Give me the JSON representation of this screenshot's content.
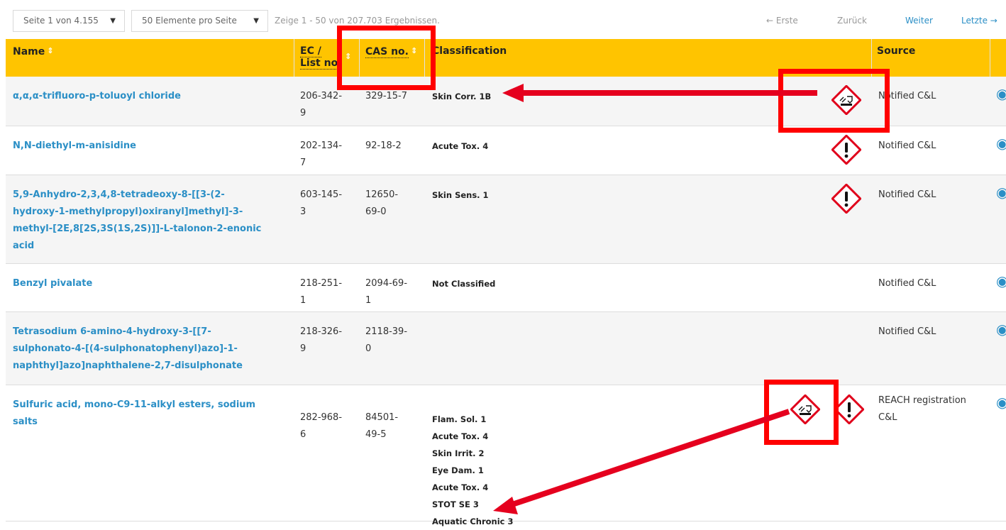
{
  "toolbar": {
    "page_select": "Seite 1 von 4.155",
    "per_page_select": "50 Elemente pro Seite",
    "results_info": "Zeige 1 - 50 von 207.703 Ergebnissen.",
    "first": "← Erste",
    "prev": "Zurück",
    "next": "Weiter",
    "last": "Letzte →"
  },
  "header": {
    "name": "Name",
    "ec_line1": "EC /",
    "ec_line2": "List no.",
    "cas": "CAS no.",
    "classification": "Classification",
    "source": "Source",
    "sort_icon": "sort-arrows-icon"
  },
  "rows": [
    {
      "name_lines": [
        "α,α,α-trifluoro-p-toluoyl chloride"
      ],
      "ec": [
        "206-342-",
        "9"
      ],
      "cas": [
        "329-15-7"
      ],
      "classification": [
        "Skin Corr. 1B"
      ],
      "pictograms": [
        "corrosion-pictogram"
      ],
      "source": [
        "Notified C&L"
      ]
    },
    {
      "name_lines": [
        "N,N-diethyl-m-anisidine"
      ],
      "ec": [
        "202-134-",
        "7"
      ],
      "cas": [
        "92-18-2"
      ],
      "classification": [
        "Acute Tox. 4"
      ],
      "pictograms": [
        "exclamation-pictogram"
      ],
      "source": [
        "Notified C&L"
      ]
    },
    {
      "name_lines": [
        "5,9-Anhydro-2,3,4,8-tetradeoxy-8-[[3-(2-",
        "hydroxy-1-methylpropyl)oxiranyl]methyl]-3-",
        "methyl-[2E,8[2S,3S(1S,2S)]]-L-talonon-2-enonic",
        "acid"
      ],
      "ec": [
        "603-145-",
        "3"
      ],
      "cas": [
        "12650-",
        "69-0"
      ],
      "classification": [
        "Skin Sens. 1"
      ],
      "pictograms": [
        "exclamation-pictogram"
      ],
      "source": [
        "Notified C&L"
      ]
    },
    {
      "name_lines": [
        "Benzyl pivalate"
      ],
      "ec": [
        "218-251-",
        "1"
      ],
      "cas": [
        "2094-69-",
        "1"
      ],
      "classification": [
        "Not Classified"
      ],
      "pictograms": [],
      "source": [
        "Notified C&L"
      ]
    },
    {
      "name_lines": [
        "Tetrasodium 6-amino-4-hydroxy-3-[[7-",
        "sulphonato-4-[(4-sulphonatophenyl)azo]-1-",
        "naphthyl]azo]naphthalene-2,7-disulphonate"
      ],
      "ec": [
        "218-326-",
        "9"
      ],
      "cas": [
        "2118-39-",
        "0"
      ],
      "classification": [],
      "pictograms": [],
      "source": [
        "Notified C&L"
      ]
    },
    {
      "name_lines": [
        "Sulfuric acid, mono-C9-11-alkyl esters, sodium",
        "salts"
      ],
      "ec": [
        "282-968-",
        "6"
      ],
      "cas": [
        "84501-",
        "49-5"
      ],
      "classification": [
        "Flam. Sol. 1",
        "Acute Tox. 4",
        "Skin Irrit. 2",
        "Eye Dam. 1",
        "Acute Tox. 4",
        "STOT SE 3",
        "Aquatic Chronic 3"
      ],
      "pictograms": [
        "corrosion-pictogram",
        "exclamation-pictogram"
      ],
      "source": [
        "REACH registration",
        "C&L"
      ]
    }
  ],
  "annotation_color": "#ff0000",
  "link_color": "#2b8fc6",
  "header_color": "#ffc400",
  "view_icon": "eye-icon"
}
